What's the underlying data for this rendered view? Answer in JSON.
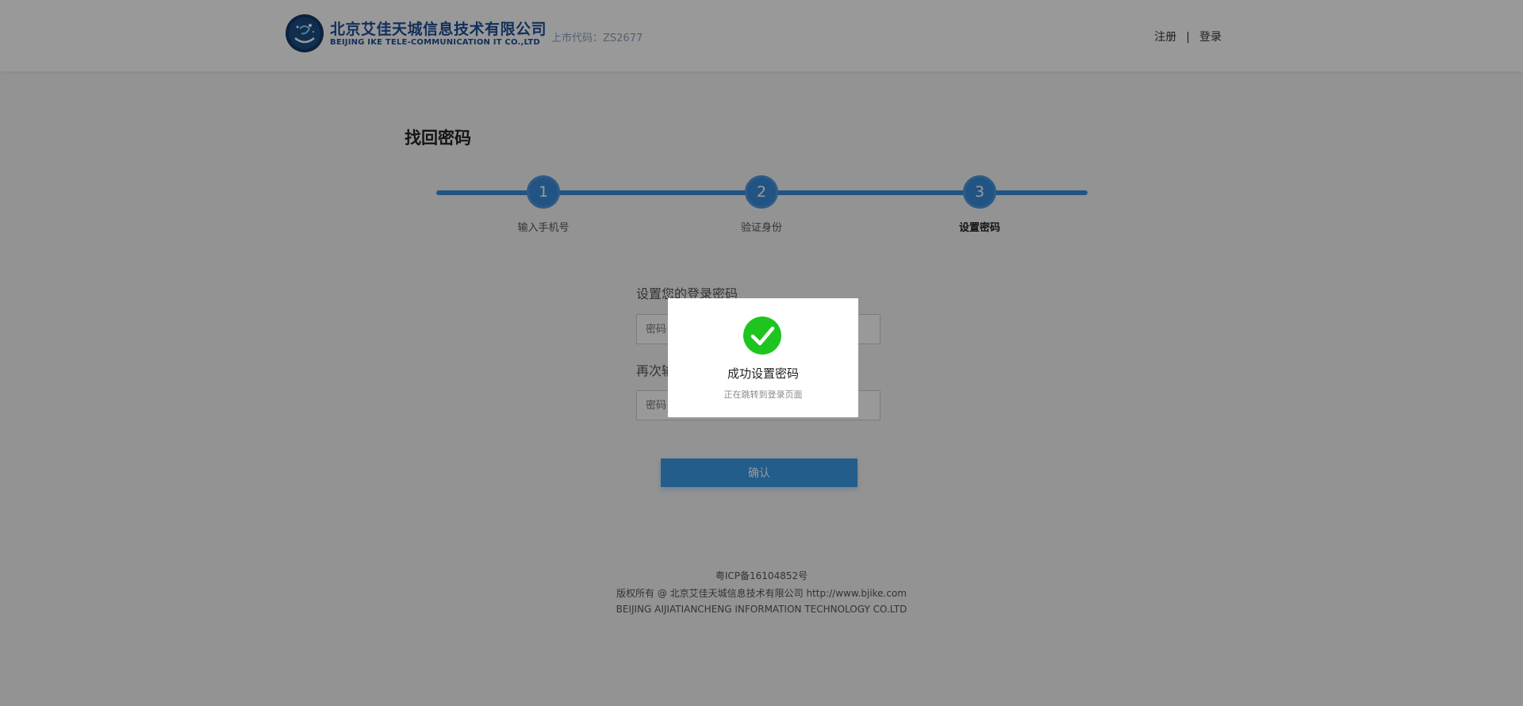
{
  "header": {
    "company_cn": "北京艾佳天城信息技术有限公司",
    "company_en": "BEIJING IKE TELE-COMMUNICATION IT CO.,LTD",
    "stock_code": "上市代码：ZS2677",
    "register": "注册",
    "separator": "|",
    "login": "登录"
  },
  "page_title": "找回密码",
  "steps": [
    {
      "number": "1",
      "label": "输入手机号"
    },
    {
      "number": "2",
      "label": "验证身份"
    },
    {
      "number": "3",
      "label": "设置密码"
    }
  ],
  "form": {
    "password_label": "设置您的登录密码",
    "password_placeholder": "密码",
    "confirm_label": "再次输入密码",
    "confirm_placeholder": "密码",
    "submit": "确认"
  },
  "footer": {
    "icp": "粤ICP备16104852号",
    "copyright": "版权所有 @ 北京艾佳天城信息技术有限公司 http://www.bjike.com",
    "company_en": "BEIJING AIJIATIANCHENG INFORMATION TECHNOLOGY CO.LTD"
  },
  "modal": {
    "icon": "success-check-icon",
    "title": "成功设置密码",
    "subtitle": "正在跳转到登录页面"
  },
  "colors": {
    "accent": "#3a8ddb",
    "brand": "#1e4f9a",
    "success": "#1fc51f"
  }
}
